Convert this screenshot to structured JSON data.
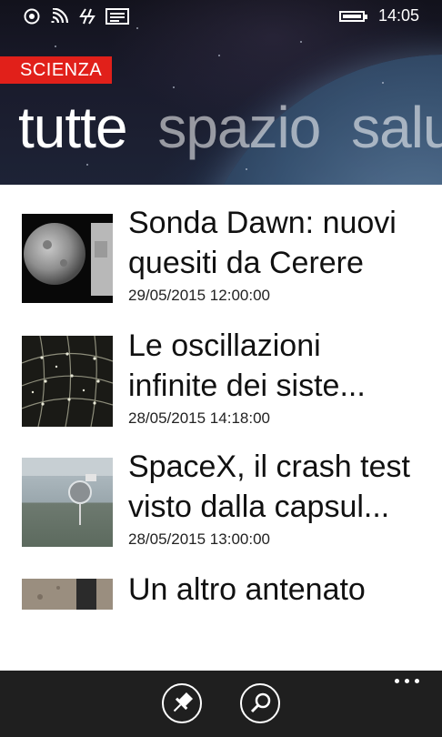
{
  "status_bar": {
    "time": "14:05",
    "icons": [
      "location-icon",
      "wifi-icon",
      "data-sync-icon",
      "message-icon",
      "battery-icon"
    ]
  },
  "app": {
    "section_label": "SCIENZA"
  },
  "pivot": {
    "items": [
      "tutte",
      "spazio",
      "salu"
    ],
    "selected": "tutte"
  },
  "news": [
    {
      "title_line1": "Sonda Dawn: nuovi",
      "title_line2": "quesiti da Cerere",
      "date": "29/05/2015 12:00:00",
      "thumb": "ceres-image"
    },
    {
      "title_line1": "Le oscillazioni",
      "title_line2": "infinite dei siste...",
      "date": "28/05/2015 14:18:00",
      "thumb": "dew-web-image"
    },
    {
      "title_line1": "SpaceX, il crash test",
      "title_line2": "visto dalla capsul...",
      "date": "28/05/2015 13:00:00",
      "thumb": "capsule-image"
    },
    {
      "title_line1": "Un altro antenato",
      "title_line2": "",
      "date": "",
      "thumb": "fossil-image"
    }
  ],
  "app_bar": {
    "buttons": [
      "pin-icon",
      "search-icon"
    ],
    "more": "more-icon"
  },
  "colors": {
    "accent": "#e1201a",
    "app_bar": "#1f1f1f",
    "header_dark": "#12121c"
  }
}
